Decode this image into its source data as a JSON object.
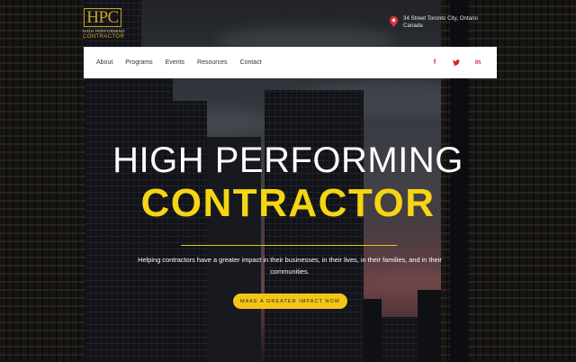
{
  "logo": {
    "mark": "HPC",
    "line1": "HIGH PERFORMING",
    "line2": "CONTRACTOR"
  },
  "address": {
    "icon": "map-pin-icon",
    "line1": "34 Street Toronto City, Ontario",
    "line2": "Canada"
  },
  "nav": {
    "items": [
      {
        "label": "About"
      },
      {
        "label": "Programs"
      },
      {
        "label": "Events"
      },
      {
        "label": "Resources"
      },
      {
        "label": "Contact"
      }
    ]
  },
  "socials": [
    {
      "name": "facebook-icon",
      "glyph": "f"
    },
    {
      "name": "twitter-icon",
      "glyph": "t"
    },
    {
      "name": "linkedin-icon",
      "glyph": "in"
    }
  ],
  "hero": {
    "title_line1": "HIGH PERFORMING",
    "title_line2": "CONTRACTOR",
    "tagline": "Helping contractors have a greater impact in their businesses, in their lives, in their families, and in their communities.",
    "cta_label": "MAKE A GREATER IMPACT NOW"
  },
  "colors": {
    "accent_yellow": "#f5d514",
    "social_red": "#d0242e",
    "logo_gold": "#c9a227"
  }
}
